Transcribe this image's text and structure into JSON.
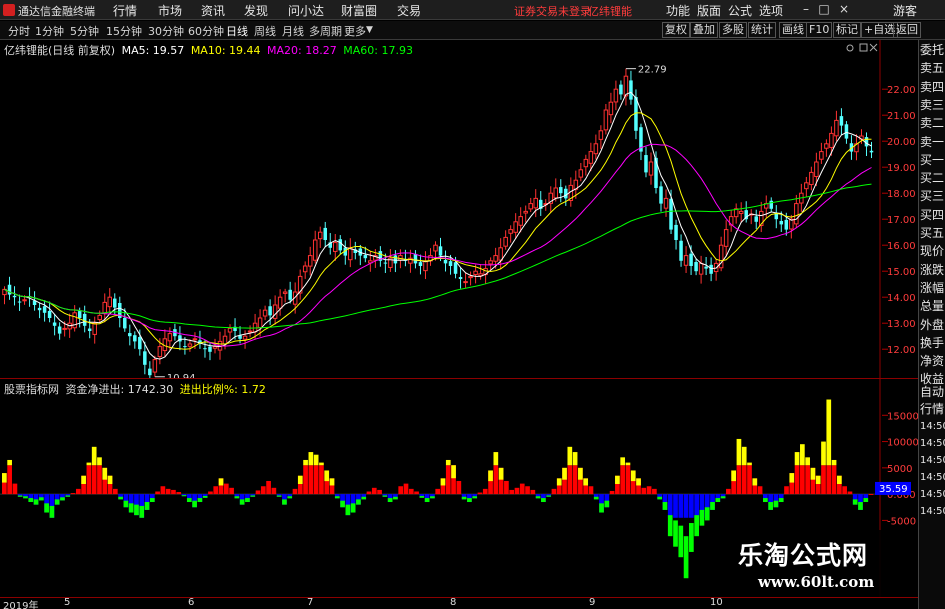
{
  "app": {
    "title": "通达信金融终端"
  },
  "menu": {
    "items": [
      "行情",
      "市场",
      "资讯",
      "发现",
      "问小达",
      "财富圈",
      "交易"
    ],
    "alert": "证券交易未登录",
    "stock_name": "亿纬锂能",
    "right_items": [
      "功能",
      "版面",
      "公式",
      "选项"
    ],
    "guest": "游客",
    "window_controls": [
      "minimize-icon",
      "maximize-icon",
      "close-icon"
    ]
  },
  "toolbar": {
    "periods": [
      "分时",
      "1分钟",
      "5分钟",
      "15分钟",
      "30分钟",
      "60分钟",
      "日线",
      "周线",
      "月线",
      "多周期",
      "更多"
    ],
    "active_period": "日线",
    "buttons": [
      "复权",
      "叠加",
      "多股",
      "统计",
      "画线",
      "F10",
      "标记",
      "+自选",
      "返回"
    ]
  },
  "kline": {
    "title": "亿纬锂能(日线 前复权)",
    "ma": [
      {
        "label": "MA5: 19.57",
        "color": "#ffffff"
      },
      {
        "label": "MA10: 19.44",
        "color": "#ffff00"
      },
      {
        "label": "MA20: 18.27",
        "color": "#ff00ff"
      },
      {
        "label": "MA60: 17.93",
        "color": "#00ff00"
      }
    ],
    "ymin": 11.2,
    "ymax": 23.2,
    "ticks": [
      "22.00",
      "21.00",
      "20.00",
      "19.00",
      "18.00",
      "17.00",
      "16.00",
      "15.00",
      "14.00",
      "13.00",
      "12.00"
    ],
    "tick_values": [
      22,
      21,
      20,
      19,
      18,
      17,
      16,
      15,
      14,
      13,
      12
    ],
    "high_label": "22.79",
    "high_value": 22.79,
    "low_label": "10.94",
    "low_value": 10.94,
    "up_color": "#ff3232",
    "down_color": "#54ffff"
  },
  "indicator": {
    "title": "股票指标网",
    "net_flow": "资金净进出: 1742.30",
    "ratio": "进出比例%: 1.72",
    "ticks": [
      "15000",
      "10000",
      "5000",
      "0.000",
      "-5000"
    ],
    "tick_values": [
      15000,
      10000,
      5000,
      0,
      -5000
    ],
    "ymin": -19000,
    "ymax": 20000,
    "current_value": "35.59",
    "colors": {
      "red": "#ff0000",
      "yellow": "#ffff00",
      "blue": "#0000ff",
      "green": "#00ff00"
    }
  },
  "right_labels": [
    "委托",
    "卖五",
    "卖四",
    "卖三",
    "卖二",
    "卖一",
    "买一",
    "买二",
    "买三",
    "买四",
    "买五",
    "现价",
    "涨跌",
    "涨幅",
    "总量",
    "外盘",
    "换手",
    "净资",
    "收益"
  ],
  "right_labels_lower": [
    "自动",
    "行情",
    "14:50",
    "14:50",
    "14:50",
    "14:50",
    "14:50",
    "14:50"
  ],
  "dates": [
    "2019年",
    "5",
    "6",
    "7",
    "8",
    "9",
    "10"
  ],
  "watermark": {
    "title": "乐淘公式网",
    "url": "www.60lt.com"
  },
  "chart_data": [
    {
      "type": "candlestick",
      "title": "亿纬锂能(日线 前复权)",
      "series": [
        {
          "name": "MA5",
          "value": 19.57
        },
        {
          "name": "MA10",
          "value": 19.44
        },
        {
          "name": "MA20",
          "value": 18.27
        },
        {
          "name": "MA60",
          "value": 17.93
        }
      ],
      "x": [
        "2019年",
        "5",
        "6",
        "7",
        "8",
        "9",
        "10"
      ],
      "ylim": [
        11.2,
        23.2
      ],
      "y_ticks": [
        22,
        21,
        20,
        19,
        18,
        17,
        16,
        15,
        14,
        13,
        12
      ],
      "annotations": [
        {
          "label": "22.79",
          "value": 22.79
        },
        {
          "label": "10.94",
          "value": 10.94
        }
      ],
      "closes": [
        14.3,
        14.1,
        14.0,
        13.8,
        13.9,
        14.0,
        13.7,
        13.5,
        13.4,
        13.2,
        12.9,
        12.6,
        12.8,
        13.0,
        13.4,
        13.2,
        12.9,
        12.7,
        13.0,
        13.3,
        13.8,
        14.0,
        13.6,
        13.2,
        12.8,
        12.5,
        12.3,
        12.0,
        11.4,
        11.0,
        11.6,
        12.1,
        12.4,
        12.6,
        12.5,
        12.3,
        12.1,
        12.2,
        12.4,
        12.2,
        12.0,
        11.9,
        12.1,
        12.3,
        12.5,
        12.8,
        12.7,
        12.4,
        12.5,
        12.7,
        13.0,
        13.2,
        13.5,
        13.3,
        13.7,
        14.0,
        14.2,
        13.9,
        14.2,
        14.8,
        15.2,
        15.6,
        16.2,
        16.5,
        16.2,
        15.9,
        16.1,
        15.8,
        15.6,
        15.9,
        15.7,
        15.6,
        15.5,
        15.4,
        15.6,
        15.4,
        15.3,
        15.5,
        15.3,
        15.6,
        15.4,
        15.5,
        15.3,
        15.2,
        15.4,
        15.6,
        16.0,
        15.6,
        15.3,
        15.2,
        14.9,
        14.7,
        14.6,
        14.8,
        15.0,
        14.9,
        15.1,
        15.4,
        15.6,
        15.9,
        16.3,
        16.6,
        16.9,
        17.1,
        17.3,
        17.6,
        17.8,
        17.4,
        17.6,
        18.0,
        18.2,
        18.0,
        17.8,
        18.3,
        18.5,
        18.9,
        19.3,
        19.6,
        19.9,
        20.4,
        21.2,
        21.5,
        22.0,
        21.8,
        22.5,
        21.6,
        20.4,
        19.6,
        18.8,
        19.2,
        18.2,
        17.6,
        17.8,
        16.6,
        16.2,
        15.4,
        15.6,
        15.2,
        15.0,
        15.3,
        15.1,
        14.9,
        15.3,
        16.0,
        16.6,
        17.1,
        17.4,
        17.3,
        17.0,
        17.2,
        16.9,
        17.3,
        17.6,
        17.4,
        17.0,
        16.8,
        16.6,
        17.0,
        17.6,
        18.0,
        18.4,
        18.8,
        19.2,
        19.6,
        19.9,
        20.3,
        20.8,
        20.6,
        20.1,
        19.6,
        19.9,
        20.2,
        19.8,
        19.57
      ]
    },
    {
      "type": "bar",
      "title": "股票指标网",
      "series": [
        {
          "name": "资金净进出",
          "value": 1742.3
        },
        {
          "name": "进出比例%",
          "value": 1.72
        }
      ],
      "ylim": [
        -19000,
        20000
      ],
      "y_ticks": [
        15000,
        10000,
        5000,
        0,
        -5000
      ],
      "current": 35.59,
      "values": [
        4000,
        6500,
        2000,
        -500,
        -800,
        -1500,
        -2000,
        -1200,
        -3500,
        -4500,
        -2000,
        -1200,
        -500,
        200,
        1000,
        3500,
        6000,
        9000,
        7000,
        5000,
        3500,
        1000,
        -1000,
        -2500,
        -3500,
        -4000,
        -4500,
        -3000,
        -1500,
        500,
        1500,
        1000,
        800,
        400,
        -400,
        -1500,
        -2500,
        -1500,
        -700,
        500,
        1500,
        3000,
        2000,
        1200,
        -800,
        -2000,
        -1500,
        -500,
        700,
        1500,
        2500,
        1200,
        -500,
        -2000,
        -800,
        1000,
        3500,
        6500,
        8000,
        7500,
        6000,
        4500,
        3000,
        -800,
        -2500,
        -4000,
        -3500,
        -2000,
        -1000,
        500,
        1200,
        800,
        -500,
        -1500,
        -1000,
        1500,
        2000,
        1000,
        500,
        -700,
        -1500,
        -800,
        1000,
        3000,
        6500,
        5500,
        2500,
        -1000,
        -1500,
        -800,
        300,
        1000,
        4500,
        8000,
        5000,
        2500,
        800,
        1200,
        2000,
        1500,
        800,
        -800,
        -1500,
        -500,
        1000,
        3000,
        5000,
        9000,
        8000,
        5000,
        3000,
        1500,
        -1000,
        -3500,
        -2500,
        600,
        3500,
        7000,
        6000,
        4500,
        3000,
        1200,
        1500,
        1000,
        -1000,
        -3000,
        -8000,
        -10000,
        -12000,
        -16000,
        -11000,
        -8000,
        -6000,
        -5000,
        -3000,
        -1500,
        -800,
        1000,
        4500,
        10500,
        9000,
        6000,
        3000,
        1500,
        -1500,
        -3000,
        -2500,
        -1500,
        1500,
        4000,
        8000,
        9500,
        7000,
        5000,
        3500,
        10000,
        18000,
        6500,
        3500,
        1500,
        500,
        -2000,
        -3000,
        -1500,
        35.59
      ]
    }
  ]
}
